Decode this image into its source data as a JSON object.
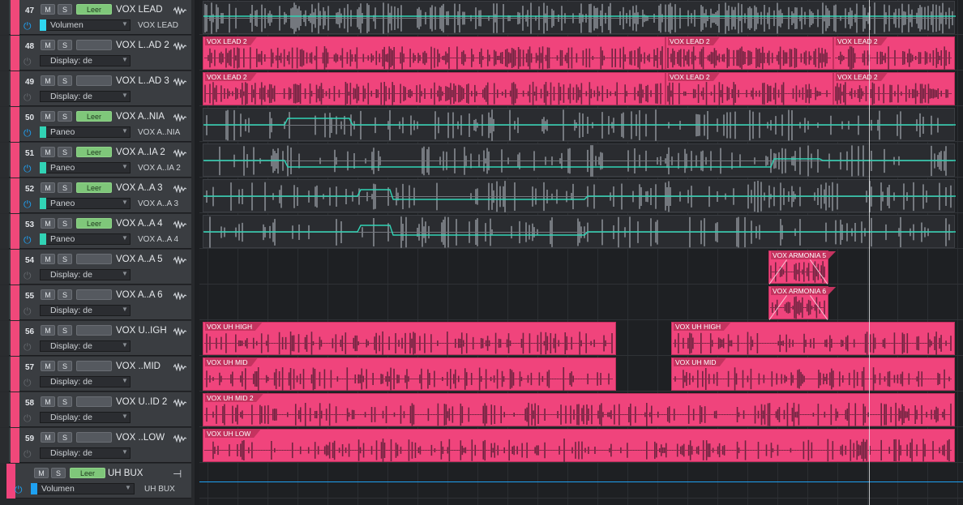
{
  "colors": {
    "track": "#f0447c",
    "clip_label": "#c4335f",
    "auto_line": "#31d3b5",
    "bus_line": "#1ea1f2",
    "panel": "#3a3d41"
  },
  "tracks": [
    {
      "num": "47",
      "name": "VOX LEAD",
      "mute": "M",
      "solo": "S",
      "leer": "Leer",
      "leer_on": true,
      "power": "on",
      "auto": "Volumen",
      "swatch": "#2fd6f0",
      "dest": "VOX LEAD"
    },
    {
      "num": "48",
      "name": "VOX L..AD 2",
      "mute": "M",
      "solo": "S",
      "leer": "",
      "leer_on": false,
      "power": "off",
      "auto": "Display: de",
      "swatch": "",
      "dest": ""
    },
    {
      "num": "49",
      "name": "VOX L..AD 3",
      "mute": "M",
      "solo": "S",
      "leer": "",
      "leer_on": false,
      "power": "off",
      "auto": "Display: de",
      "swatch": "",
      "dest": ""
    },
    {
      "num": "50",
      "name": "VOX A..NIA",
      "mute": "M",
      "solo": "S",
      "leer": "Leer",
      "leer_on": true,
      "power": "on",
      "auto": "Paneo",
      "swatch": "#31d3b5",
      "dest": "VOX A..NIA"
    },
    {
      "num": "51",
      "name": "VOX A..IA 2",
      "mute": "M",
      "solo": "S",
      "leer": "Leer",
      "leer_on": true,
      "power": "on",
      "auto": "Paneo",
      "swatch": "#31d3b5",
      "dest": "VOX A..IA 2"
    },
    {
      "num": "52",
      "name": "VOX A..A  3",
      "mute": "M",
      "solo": "S",
      "leer": "Leer",
      "leer_on": true,
      "power": "on",
      "auto": "Paneo",
      "swatch": "#31d3b5",
      "dest": "VOX A..A  3"
    },
    {
      "num": "53",
      "name": "VOX A..A  4",
      "mute": "M",
      "solo": "S",
      "leer": "Leer",
      "leer_on": true,
      "power": "on",
      "auto": "Paneo",
      "swatch": "#31d3b5",
      "dest": "VOX A..A  4"
    },
    {
      "num": "54",
      "name": "VOX A..A  5",
      "mute": "M",
      "solo": "S",
      "leer": "",
      "leer_on": false,
      "power": "off",
      "auto": "Display: de",
      "swatch": "",
      "dest": ""
    },
    {
      "num": "55",
      "name": "VOX A..A  6",
      "mute": "M",
      "solo": "S",
      "leer": "",
      "leer_on": false,
      "power": "off",
      "auto": "Display: de",
      "swatch": "",
      "dest": ""
    },
    {
      "num": "56",
      "name": "VOX U..IGH",
      "mute": "M",
      "solo": "S",
      "leer": "",
      "leer_on": false,
      "power": "off",
      "auto": "Display: de",
      "swatch": "",
      "dest": ""
    },
    {
      "num": "57",
      "name": "VOX ..MID",
      "mute": "M",
      "solo": "S",
      "leer": "",
      "leer_on": false,
      "power": "off",
      "auto": "Display: de",
      "swatch": "",
      "dest": ""
    },
    {
      "num": "58",
      "name": "VOX U..ID 2",
      "mute": "M",
      "solo": "S",
      "leer": "",
      "leer_on": false,
      "power": "off",
      "auto": "Display: de",
      "swatch": "",
      "dest": ""
    },
    {
      "num": "59",
      "name": "VOX ..LOW",
      "mute": "M",
      "solo": "S",
      "leer": "",
      "leer_on": false,
      "power": "off",
      "auto": "Display: de",
      "swatch": "",
      "dest": ""
    }
  ],
  "bus": {
    "num": "",
    "name": "UH BUX",
    "mute": "M",
    "solo": "S",
    "leer": "Leer",
    "leer_on": true,
    "power": "on",
    "auto": "Volumen",
    "swatch": "#1ea1f2",
    "dest": "UH BUX"
  },
  "clips": [
    {
      "row": 1,
      "label": "VOX LEAD 2"
    },
    {
      "row": 1,
      "label": "VOX LEAD 2"
    },
    {
      "row": 1,
      "label": "VOX LEAD 2"
    },
    {
      "row": 2,
      "label": "VOX LEAD 2"
    },
    {
      "row": 2,
      "label": "VOX LEAD 2"
    },
    {
      "row": 2,
      "label": "VOX LEAD 2"
    },
    {
      "row": 7,
      "label": "VOX ARMONIA 5"
    },
    {
      "row": 8,
      "label": "VOX ARMONIA 6"
    },
    {
      "row": 9,
      "label": "VOX UH HIGH"
    },
    {
      "row": 9,
      "label": "VOX UH HIGH"
    },
    {
      "row": 10,
      "label": "VOX UH MID"
    },
    {
      "row": 10,
      "label": "VOX UH MID"
    },
    {
      "row": 11,
      "label": "VOX UH MID 2"
    },
    {
      "row": 12,
      "label": "VOX UH LOW"
    }
  ]
}
